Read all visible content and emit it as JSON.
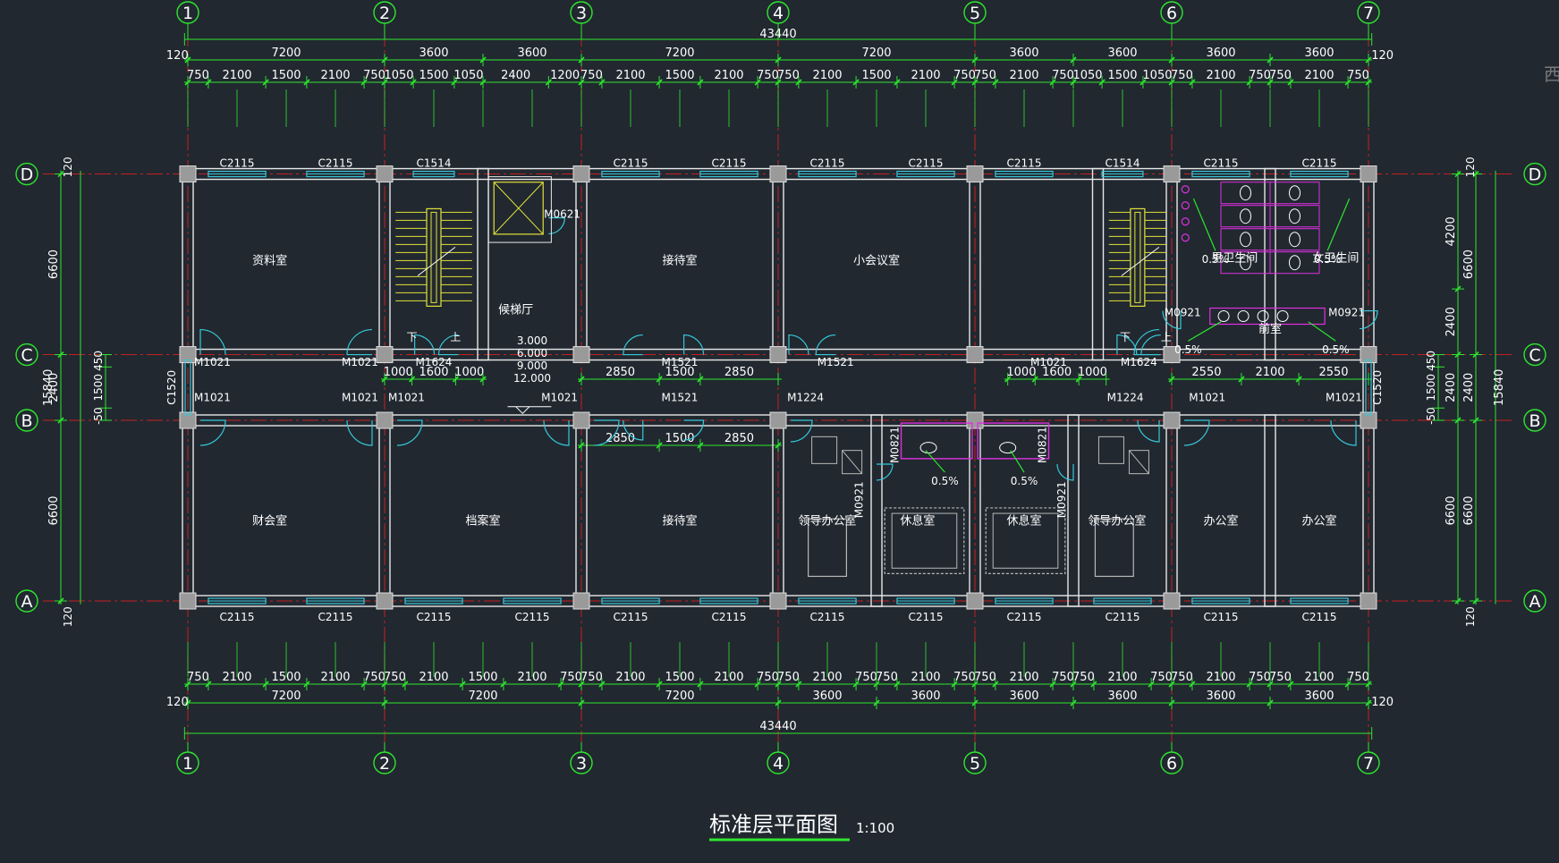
{
  "colors": {
    "background": "#212830",
    "dimension": "#2ee62e",
    "axis_line": "#c62020",
    "wall": "#e8e8e8",
    "window": "#3ac6d8",
    "door": "#36c8d8",
    "stair": "#e2e23a",
    "fixture": "#e030e0",
    "furniture": "#b8b8b8",
    "text": "#ffffff"
  },
  "title": {
    "text": "标准层平面图",
    "scale": "1:100"
  },
  "grid": {
    "vertical": [
      "1",
      "2",
      "3",
      "4",
      "5",
      "6",
      "7"
    ],
    "horizontal": [
      "D",
      "C",
      "B",
      "A"
    ],
    "x_mm": [
      0,
      7200,
      14400,
      21600,
      28800,
      36000,
      43200
    ],
    "y_mm": [
      15600,
      9000,
      6600,
      0
    ]
  },
  "dimensions": {
    "overall": "43440",
    "overall_height": "15840",
    "top_bays": [
      {
        "label": "7200",
        "span_mm": 7200
      },
      {
        "label": "3600",
        "span_mm": 3600
      },
      {
        "label": "3600",
        "span_mm": 3600
      },
      {
        "label": "7200",
        "span_mm": 7200
      },
      {
        "label": "7200",
        "span_mm": 7200
      },
      {
        "label": "3600",
        "span_mm": 3600
      },
      {
        "label": "3600",
        "span_mm": 3600
      },
      {
        "label": "3600",
        "span_mm": 3600
      },
      {
        "label": "3600",
        "span_mm": 3600
      }
    ],
    "top_details": [
      {
        "label": "750",
        "span_mm": 750
      },
      {
        "label": "2100",
        "span_mm": 2100
      },
      {
        "label": "1500",
        "span_mm": 1500
      },
      {
        "label": "2100",
        "span_mm": 2100
      },
      {
        "label": "750",
        "span_mm": 750
      },
      {
        "label": "1050",
        "span_mm": 1050
      },
      {
        "label": "1500",
        "span_mm": 1500
      },
      {
        "label": "1050",
        "span_mm": 1050
      },
      {
        "label": "2400",
        "span_mm": 2400
      },
      {
        "label": "1200",
        "span_mm": 1200
      },
      {
        "label": "750",
        "span_mm": 750
      },
      {
        "label": "2100",
        "span_mm": 2100
      },
      {
        "label": "1500",
        "span_mm": 1500
      },
      {
        "label": "2100",
        "span_mm": 2100
      },
      {
        "label": "750",
        "span_mm": 750
      },
      {
        "label": "750",
        "span_mm": 750
      },
      {
        "label": "2100",
        "span_mm": 2100
      },
      {
        "label": "1500",
        "span_mm": 1500
      },
      {
        "label": "2100",
        "span_mm": 2100
      },
      {
        "label": "750",
        "span_mm": 750
      },
      {
        "label": "750",
        "span_mm": 750
      },
      {
        "label": "2100",
        "span_mm": 2100
      },
      {
        "label": "750",
        "span_mm": 750
      },
      {
        "label": "1050",
        "span_mm": 1050
      },
      {
        "label": "1500",
        "span_mm": 1500
      },
      {
        "label": "1050",
        "span_mm": 1050
      },
      {
        "label": "750",
        "span_mm": 750
      },
      {
        "label": "2100",
        "span_mm": 2100
      },
      {
        "label": "750",
        "span_mm": 750
      },
      {
        "label": "750",
        "span_mm": 750
      },
      {
        "label": "2100",
        "span_mm": 2100
      },
      {
        "label": "750",
        "span_mm": 750
      }
    ],
    "bottom_bays": [
      {
        "label": "7200",
        "span_mm": 7200
      },
      {
        "label": "7200",
        "span_mm": 7200
      },
      {
        "label": "7200",
        "span_mm": 7200
      },
      {
        "label": "3600",
        "span_mm": 3600
      },
      {
        "label": "3600",
        "span_mm": 3600
      },
      {
        "label": "3600",
        "span_mm": 3600
      },
      {
        "label": "3600",
        "span_mm": 3600
      },
      {
        "label": "3600",
        "span_mm": 3600
      },
      {
        "label": "3600",
        "span_mm": 3600
      }
    ],
    "bottom_details": [
      {
        "label": "750",
        "span_mm": 750
      },
      {
        "label": "2100",
        "span_mm": 2100
      },
      {
        "label": "1500",
        "span_mm": 1500
      },
      {
        "label": "2100",
        "span_mm": 2100
      },
      {
        "label": "750",
        "span_mm": 750
      },
      {
        "label": "750",
        "span_mm": 750
      },
      {
        "label": "2100",
        "span_mm": 2100
      },
      {
        "label": "1500",
        "span_mm": 1500
      },
      {
        "label": "2100",
        "span_mm": 2100
      },
      {
        "label": "750",
        "span_mm": 750
      },
      {
        "label": "750",
        "span_mm": 750
      },
      {
        "label": "2100",
        "span_mm": 2100
      },
      {
        "label": "1500",
        "span_mm": 1500
      },
      {
        "label": "2100",
        "span_mm": 2100
      },
      {
        "label": "750",
        "span_mm": 750
      },
      {
        "label": "750",
        "span_mm": 750
      },
      {
        "label": "2100",
        "span_mm": 2100
      },
      {
        "label": "750",
        "span_mm": 750
      },
      {
        "label": "750",
        "span_mm": 750
      },
      {
        "label": "2100",
        "span_mm": 2100
      },
      {
        "label": "750",
        "span_mm": 750
      },
      {
        "label": "750",
        "span_mm": 750
      },
      {
        "label": "2100",
        "span_mm": 2100
      },
      {
        "label": "750",
        "span_mm": 750
      },
      {
        "label": "750",
        "span_mm": 750
      },
      {
        "label": "2100",
        "span_mm": 2100
      },
      {
        "label": "750",
        "span_mm": 750
      },
      {
        "label": "750",
        "span_mm": 750
      },
      {
        "label": "2100",
        "span_mm": 2100
      },
      {
        "label": "750",
        "span_mm": 750
      },
      {
        "label": "750",
        "span_mm": 750
      },
      {
        "label": "2100",
        "span_mm": 2100
      },
      {
        "label": "750",
        "span_mm": 750
      }
    ],
    "edge_offset": "120",
    "left_outer": "15840",
    "left_bays": [
      {
        "label": "6600",
        "span_mm": 6600
      },
      {
        "label": "2400",
        "span_mm": 2400
      },
      {
        "label": "6600",
        "span_mm": 6600
      }
    ],
    "left_inner": [
      {
        "label": "450",
        "span_mm": 450
      },
      {
        "label": "1500",
        "span_mm": 1500
      },
      {
        "label": "-50",
        "span_mm": 450
      }
    ],
    "right_outer": "15840",
    "right_bays": [
      {
        "label": "4200",
        "span_mm": 4200
      },
      {
        "label": "2400",
        "span_mm": 2400
      },
      {
        "label": "2400",
        "span_mm": 2400
      },
      {
        "label": "6600",
        "span_mm": 6600
      }
    ],
    "right_inner": [
      {
        "label": "450",
        "span_mm": 450
      },
      {
        "label": "1500",
        "span_mm": 1500
      },
      {
        "label": "-50",
        "span_mm": 450
      }
    ],
    "corridor_north": [
      {
        "label": "1000",
        "span_mm": 1000
      },
      {
        "label": "1600",
        "span_mm": 1600
      },
      {
        "label": "1000",
        "span_mm": 1000
      },
      {
        "label": "2850",
        "span_mm": 2850
      },
      {
        "label": "1500",
        "span_mm": 1500
      },
      {
        "label": "2850",
        "span_mm": 2850
      },
      {
        "label": "1000",
        "span_mm": 1000
      },
      {
        "label": "1600",
        "span_mm": 1600
      },
      {
        "label": "1000",
        "span_mm": 1000
      },
      {
        "label": "2550",
        "span_mm": 2550
      },
      {
        "label": "2100",
        "span_mm": 2100
      },
      {
        "label": "2550",
        "span_mm": 2550
      }
    ],
    "corridor_south": [
      {
        "label": "2850",
        "span_mm": 2850
      },
      {
        "label": "1500",
        "span_mm": 1500
      },
      {
        "label": "2850",
        "span_mm": 2850
      }
    ]
  },
  "rooms": {
    "archive_data": "资料室",
    "reception_1": "接待室",
    "meeting_small": "小会议室",
    "elevator_hall": "候梯厅",
    "toilet_men": "男卫生间",
    "toilet_women": "女卫生间",
    "anteroom": "前室",
    "finance": "财会室",
    "records": "档案室",
    "reception_2": "接待室",
    "leader_office_1": "领导办公室",
    "rest_1": "休息室",
    "rest_2": "休息室",
    "leader_office_2": "领导办公室",
    "office_1": "办公室",
    "office_2": "办公室"
  },
  "windows": {
    "w2115": "C2115",
    "w1514": "C1514",
    "w1520": "C1520"
  },
  "doors": {
    "m1021": "M1021",
    "m1624": "M1624",
    "m1521": "M1521",
    "m1224": "M1224",
    "m0921": "M0921",
    "m0821": "M0821",
    "m0621": "M0621"
  },
  "stair_labels": {
    "down": "下",
    "up": "上"
  },
  "slopes": {
    "p05": "0.5%"
  },
  "elevations": [
    "12.000",
    "9.000",
    "6.000",
    "3.000"
  ],
  "edge_glyph": "西"
}
